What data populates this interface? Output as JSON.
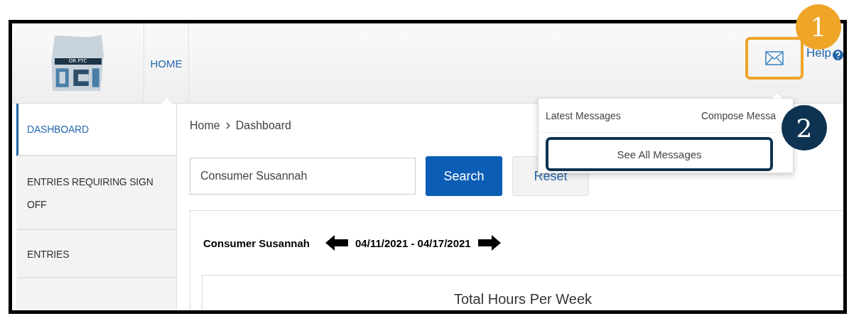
{
  "header": {
    "logo_text": "OR PTC",
    "nav": [
      {
        "label": "HOME",
        "selected": true
      }
    ],
    "help": "Help"
  },
  "messages_menu": {
    "latest": "Latest Messages",
    "compose": "Compose Messa",
    "see_all": "See All Messages"
  },
  "sidebar": {
    "items": [
      {
        "label": "DASHBOARD",
        "selected": true
      },
      {
        "label": "ENTRIES REQUIRING SIGN OFF",
        "selected": false
      },
      {
        "label": "ENTRIES",
        "selected": false
      }
    ]
  },
  "breadcrumb": [
    "Home",
    "Dashboard"
  ],
  "search": {
    "value": "Consumer Susannah",
    "button": "Search",
    "reset": "Reset"
  },
  "week": {
    "consumer": "Consumer Susannah",
    "range": "04/11/2021 - 04/17/2021"
  },
  "panel_title": "Total Hours Per Week",
  "callouts": [
    {
      "number": "1",
      "color": "#eea528"
    },
    {
      "number": "2",
      "color": "#0e3352"
    }
  ]
}
